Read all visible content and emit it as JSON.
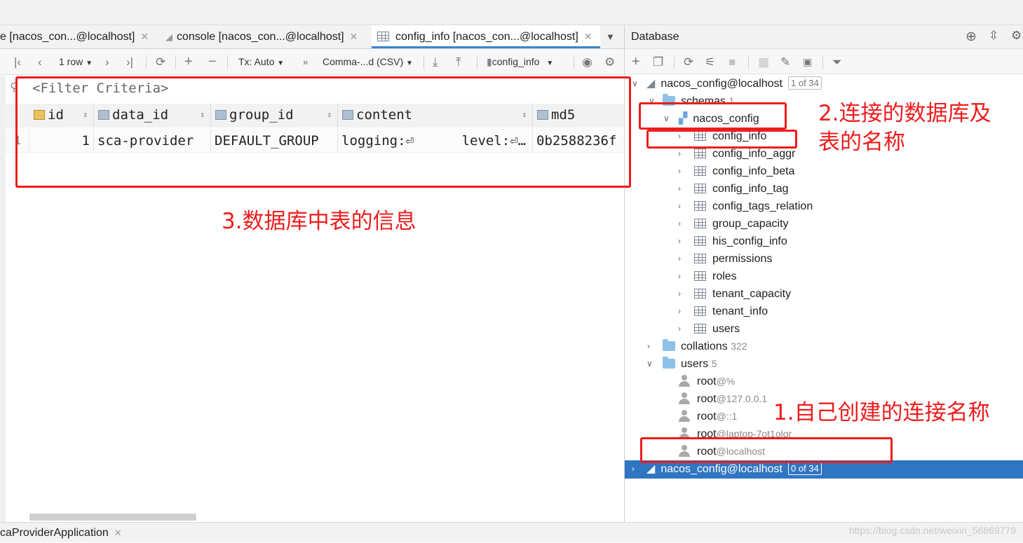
{
  "editor_tabs": [
    {
      "label": "e [nacos_con...@localhost]",
      "active": false
    },
    {
      "label": "console [nacos_con...@localhost]",
      "active": false
    },
    {
      "label": "config_info [nacos_con...@localhost]",
      "active": true
    }
  ],
  "toolbar": {
    "rows_label": "1 row",
    "tx_label": "Tx: Auto",
    "export_label": "Comma-...d (CSV)",
    "table_selector": "config_info"
  },
  "filter": {
    "placeholder": "<Filter Criteria>"
  },
  "grid": {
    "columns": [
      "id",
      "data_id",
      "group_id",
      "content",
      "md5"
    ],
    "rows": [
      {
        "row_number": "1",
        "id": "1",
        "data_id": "sca-provider",
        "group_id": "DEFAULT_GROUP",
        "content": "logging:⏎      level:⏎…",
        "md5": "0b2588236f"
      }
    ]
  },
  "database_panel": {
    "title": "Database",
    "connection": {
      "name": "nacos_config@localhost",
      "badge": "1 of 34"
    },
    "schemas": {
      "label": "schemas",
      "count": "1"
    },
    "schema_name": "nacos_config",
    "tables": [
      "config_info",
      "config_info_aggr",
      "config_info_beta",
      "config_info_tag",
      "config_tags_relation",
      "group_capacity",
      "his_config_info",
      "permissions",
      "roles",
      "tenant_capacity",
      "tenant_info",
      "users"
    ],
    "collations": {
      "label": "collations",
      "count": "322"
    },
    "users": {
      "label": "users",
      "count": "5"
    },
    "user_entries": [
      {
        "name": "root",
        "host": "@%"
      },
      {
        "name": "root",
        "host": "@127.0.0.1"
      },
      {
        "name": "root",
        "host": "@::1"
      },
      {
        "name": "root",
        "host": "@laptop-7ot1olgr"
      },
      {
        "name": "root",
        "host": "@localhost"
      }
    ],
    "second_connection": {
      "name": "nacos_config@localhost",
      "badge": "0 of 34"
    }
  },
  "annotations": {
    "a1": "1.自己创建的连接名称",
    "a2_line1": "2.连接的数据库及",
    "a2_line2": "表的名称",
    "a3": "3.数据库中表的信息"
  },
  "bottom_bar": {
    "label": "caProviderApplication"
  },
  "watermark": "https://blog.csdn.net/weixin_56869779",
  "colors": {
    "annotation_red": "#ee1c1c",
    "selection_blue": "#2f75c2",
    "folder_blue": "#8cc2e8"
  }
}
